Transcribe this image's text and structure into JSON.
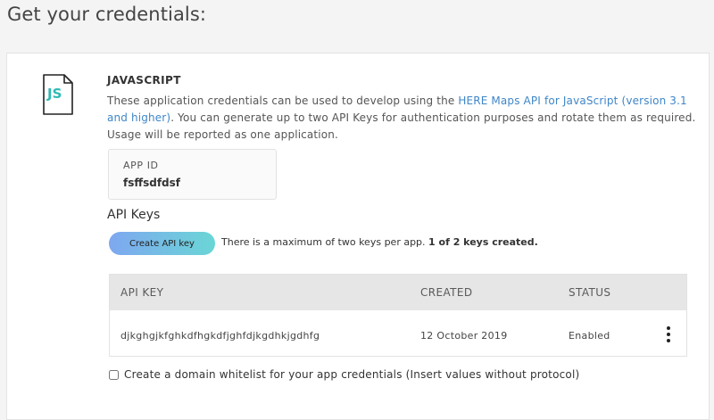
{
  "page": {
    "title": "Get your credentials:"
  },
  "section": {
    "icon_label": "JS",
    "title": "JAVASCRIPT",
    "description_before": "These application credentials can be used to develop using the ",
    "description_link": "HERE Maps API for JavaScript (version 3.1 and higher)",
    "description_after": ". You can generate up to two API Keys for authentication purposes and rotate them as required. Usage will be reported as one application."
  },
  "app_id": {
    "label": "APP ID",
    "value": "fsffsdfdsf"
  },
  "api_keys": {
    "title": "API Keys",
    "create_button": "Create API key",
    "note": "There is a maximum of two keys per app.",
    "count_text": "1 of 2 keys created."
  },
  "table": {
    "headers": {
      "key": "API KEY",
      "created": "CREATED",
      "status": "STATUS"
    },
    "rows": [
      {
        "key": "djkghgjkfghkdfhgkdfjghfdjkgdhkjgdhfg",
        "created": "12 October 2019",
        "status": "Enabled"
      }
    ]
  },
  "whitelist": {
    "label": "Create a domain whitelist for your app credentials (Insert values without protocol)",
    "checked": false
  },
  "colors": {
    "link": "#3f86c8",
    "icon_accent": "#2fb9b3",
    "button_start": "#7ea7f0",
    "button_end": "#6ad6d6"
  },
  "icons": {
    "file": "js-file-icon",
    "menu": "kebab-menu-icon"
  }
}
